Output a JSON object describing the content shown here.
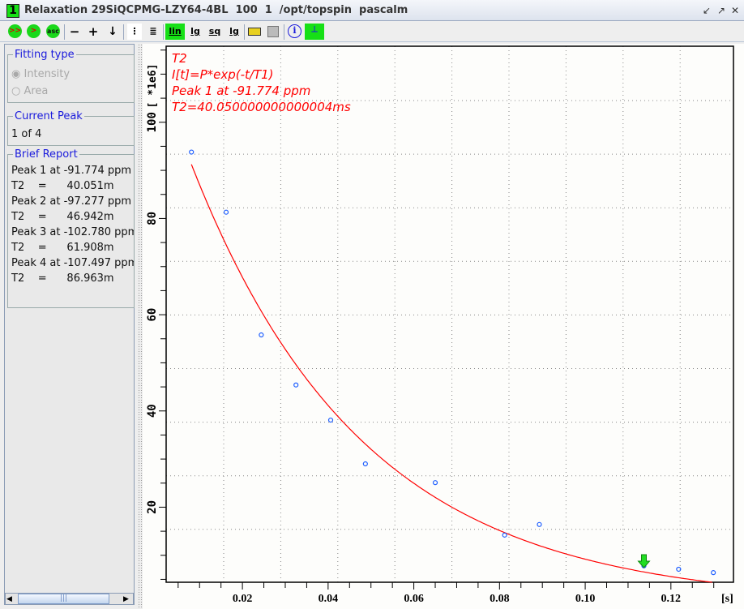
{
  "window": {
    "number": "1",
    "title": "Relaxation 29SiQCPMG-LZY64-4BL  100  1  /opt/topspin  pascalm"
  },
  "toolbar": {
    "buttons": [
      ">>",
      ">",
      "asc",
      "−",
      "+",
      "↓",
      "⋮",
      "≣",
      "lin",
      "lg",
      "sq",
      "lg",
      "folder-icon",
      "save-icon",
      "i",
      "peak-icon"
    ],
    "active": [
      "lin",
      "peak-icon"
    ]
  },
  "left_panel": {
    "fitting_type": {
      "title": "Fitting type",
      "options": [
        "Intensity",
        "Area"
      ],
      "selected": "Intensity"
    },
    "current_peak": {
      "title": "Current Peak",
      "value": "1 of 4"
    },
    "brief_report": {
      "title": "Brief Report",
      "lines": [
        "Peak 1 at -91.774 ppm",
        "T2    =      40.051m",
        "Peak 2 at -97.277 ppm",
        "T2    =      46.942m",
        "Peak 3 at -102.780 ppm",
        "T2    =      61.908m",
        "Peak 4 at -107.497 ppm",
        "T2    =      86.963m"
      ]
    }
  },
  "chart_data": {
    "type": "scatter",
    "annotation": [
      "T2",
      "I[t]=P*exp(-t/T1)",
      "Peak 1 at -91.774 ppm",
      "T2=40.050000000000004ms"
    ],
    "xlabel": "[s]",
    "ylabel": "[ *1e6]",
    "xlim": [
      0.0022,
      0.1346
    ],
    "ylim": [
      4.4,
      115.8
    ],
    "xticks": [
      "0.02",
      "0.04",
      "0.06",
      "0.08",
      "0.10",
      "0.12"
    ],
    "yticks": [
      "20",
      "40",
      "60",
      "80",
      "100"
    ],
    "grid": true,
    "points": {
      "x": [
        0.0081,
        0.0162,
        0.0244,
        0.0325,
        0.0406,
        0.0487,
        0.065,
        0.0812,
        0.0893,
        0.1137,
        0.1218,
        0.1299
      ],
      "y": [
        93.8,
        81.3,
        55.8,
        45.4,
        38.1,
        29.0,
        25.1,
        14.2,
        16.4,
        7.8,
        7.1,
        6.4
      ]
    },
    "fit": {
      "P": 111.7,
      "T2": 0.04005,
      "xrange": [
        0.0081,
        0.1301
      ]
    },
    "marker_x": 0.1137,
    "colors": {
      "points": "#1f5fff",
      "fit": "#ff0000",
      "annotation": "#ff0000",
      "marker": "#22dd22"
    }
  }
}
